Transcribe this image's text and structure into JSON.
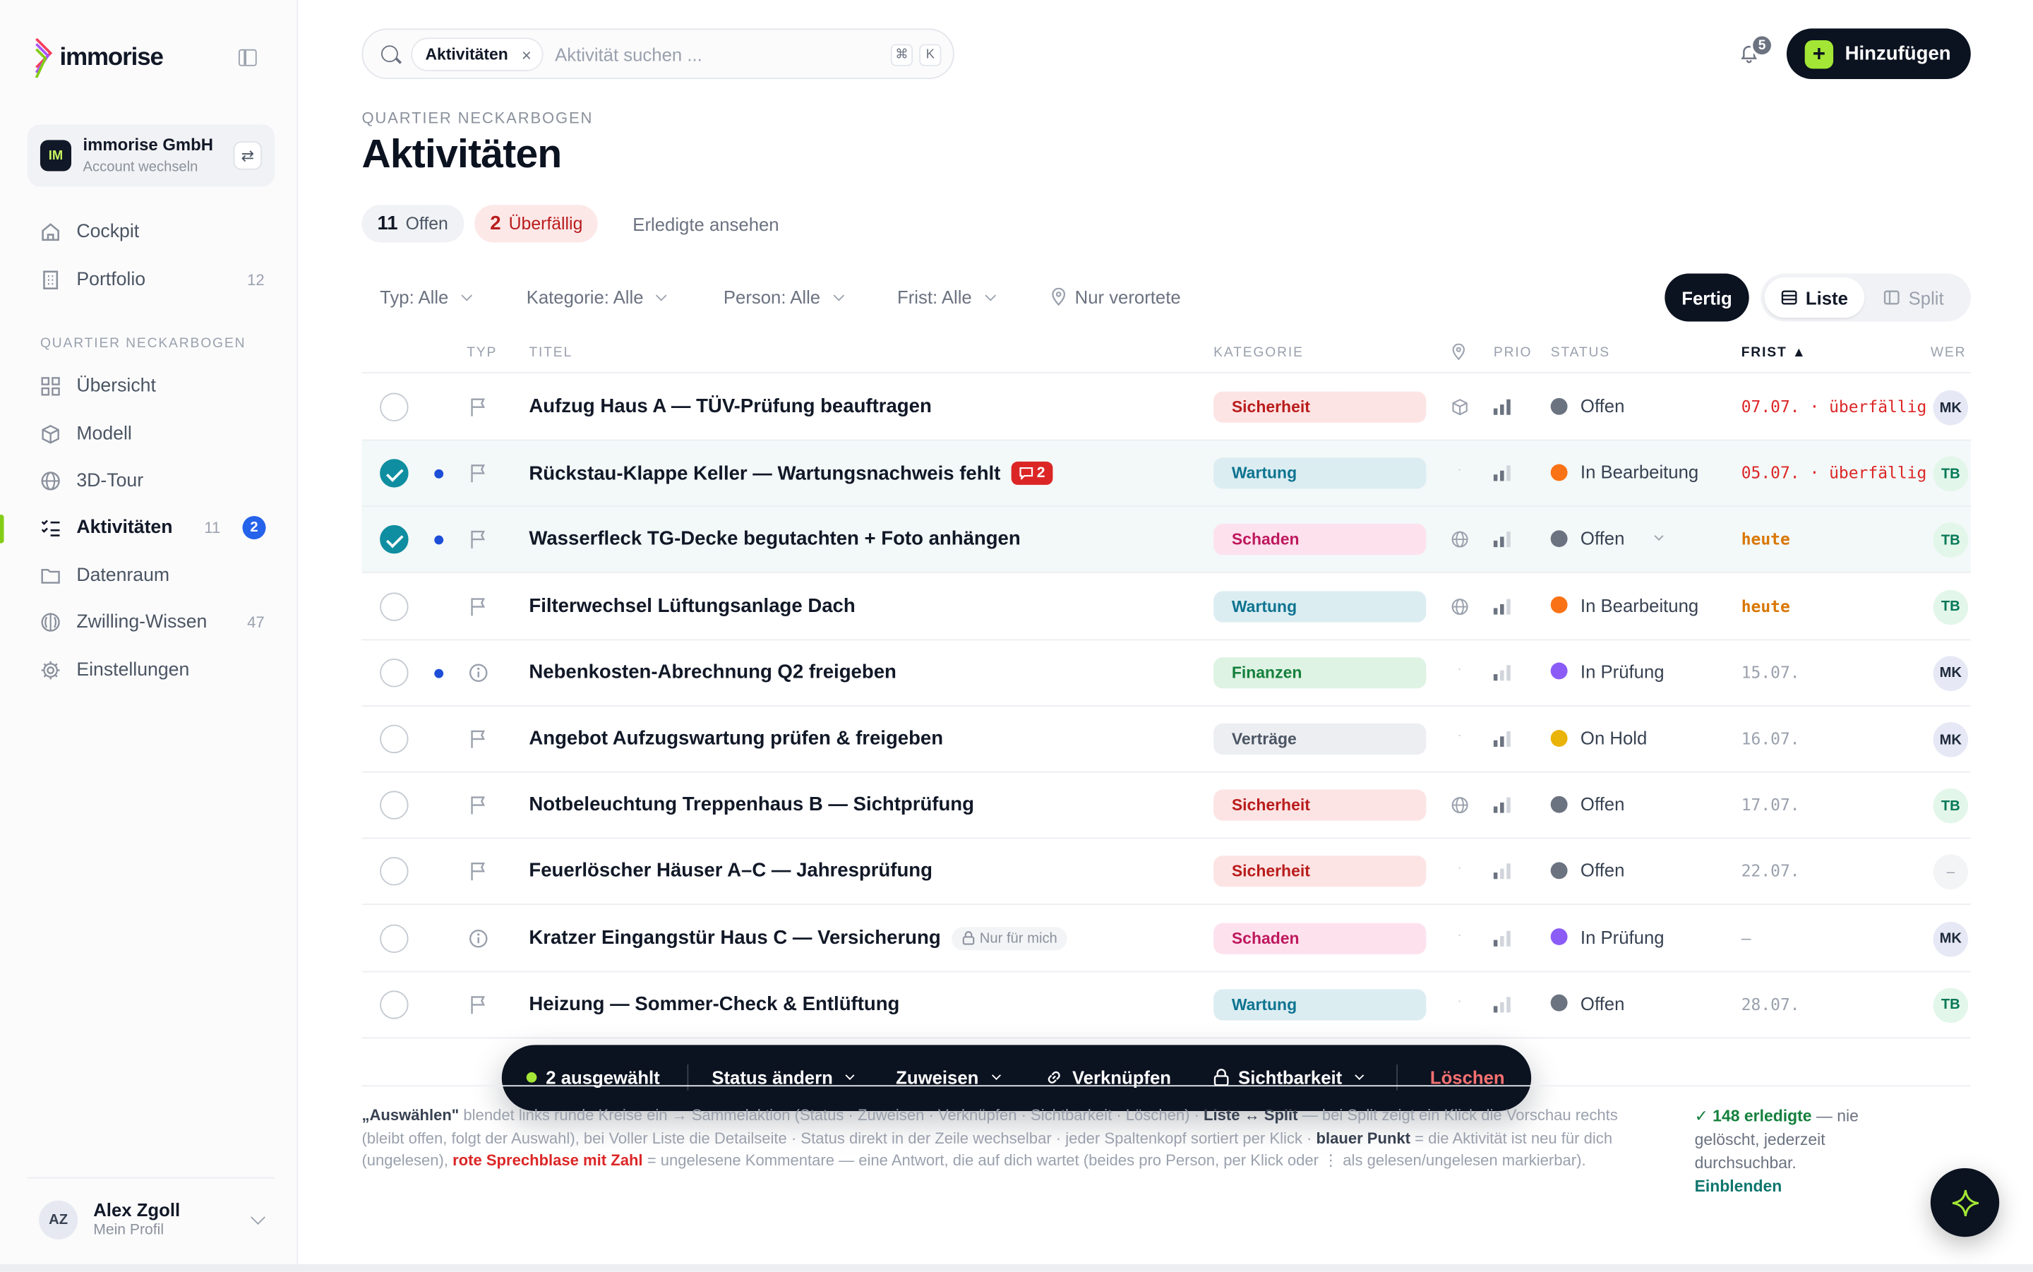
{
  "brand": {
    "name": "immorise"
  },
  "account": {
    "initials": "IM",
    "name": "immorise GmbH",
    "sub": "Account wechseln"
  },
  "nav": {
    "main": [
      {
        "label": "Cockpit",
        "icon": "home-icon",
        "count": ""
      },
      {
        "label": "Portfolio",
        "icon": "building-icon",
        "count": "12"
      }
    ],
    "section_label": "QUARTIER NECKARBOGEN",
    "section": [
      {
        "label": "Übersicht",
        "icon": "grid-icon",
        "count": ""
      },
      {
        "label": "Modell",
        "icon": "cube-icon",
        "count": ""
      },
      {
        "label": "3D-Tour",
        "icon": "globe-icon",
        "count": ""
      },
      {
        "label": "Aktivitäten",
        "icon": "checklist-icon",
        "count": "11",
        "badge": "2",
        "active": true
      },
      {
        "label": "Datenraum",
        "icon": "folder-icon",
        "count": ""
      },
      {
        "label": "Zwilling-Wissen",
        "icon": "brain-icon",
        "count": "47"
      },
      {
        "label": "Einstellungen",
        "icon": "gear-icon",
        "count": ""
      }
    ]
  },
  "profile": {
    "initials": "AZ",
    "name": "Alex Zgoll",
    "sub": "Mein Profil"
  },
  "search": {
    "chip": "Aktivitäten",
    "placeholder": "Aktivität suchen ...",
    "kbd1": "⌘",
    "kbd2": "K"
  },
  "notifications": {
    "count": "5"
  },
  "add_button": {
    "label": "Hinzufügen"
  },
  "header": {
    "eyebrow": "QUARTIER NECKARBOGEN",
    "title": "Aktivitäten"
  },
  "tabs": {
    "open": {
      "count": "11",
      "label": "Offen"
    },
    "overdue": {
      "count": "2",
      "label": "Überfällig"
    },
    "done": {
      "label": "Erledigte ansehen"
    }
  },
  "filters": [
    {
      "label": "Typ: Alle"
    },
    {
      "label": "Kategorie: Alle"
    },
    {
      "label": "Person: Alle"
    },
    {
      "label": "Frist: Alle"
    }
  ],
  "located_filter": "Nur verortete",
  "fertig_label": "Fertig",
  "view": {
    "list": "Liste",
    "split": "Split"
  },
  "columns": {
    "type": "TYP",
    "title": "TITEL",
    "category": "KATEGORIE",
    "prio": "PRIO",
    "status": "STATUS",
    "deadline": "FRIST ▲",
    "who": "WER"
  },
  "colors": {
    "Sicherheit": {
      "bg": "#fde4e4",
      "fg": "#b91c1c"
    },
    "Wartung": {
      "bg": "#dcedf2",
      "fg": "#0e7490"
    },
    "Schaden": {
      "bg": "#fde2ee",
      "fg": "#be185d"
    },
    "Finanzen": {
      "bg": "#def3e3",
      "fg": "#15803d"
    },
    "Verträge": {
      "bg": "#eceef2",
      "fg": "#4b5563"
    },
    "Offen": "#6b7280",
    "In Bearbeitung": "#f97316",
    "In Prüfung": "#8b5cf6",
    "On Hold": "#eab308"
  },
  "rows": [
    {
      "checked": false,
      "new": false,
      "type": "flag",
      "title": "Aufzug Haus A — TÜV-Prüfung beauftragen",
      "comments": "",
      "private": "",
      "category": "Sicherheit",
      "loc": "cube",
      "prio": 3,
      "status": "Offen",
      "status_dd": false,
      "deadline": "07.07.  · überfällig",
      "deadline_kind": "over",
      "who": "MK"
    },
    {
      "checked": true,
      "new": true,
      "type": "flag",
      "title": "Rückstau-Klappe Keller — Wartungsnachweis fehlt",
      "comments": "2",
      "private": "",
      "category": "Wartung",
      "loc": "none",
      "prio": 2,
      "status": "In Bearbeitung",
      "status_dd": false,
      "deadline": "05.07.  · überfällig",
      "deadline_kind": "over",
      "who": "TB"
    },
    {
      "checked": true,
      "new": true,
      "type": "flag",
      "title": "Wasserfleck TG-Decke begutachten + Foto anhängen",
      "comments": "",
      "private": "",
      "category": "Schaden",
      "loc": "globe",
      "prio": 2,
      "status": "Offen",
      "status_dd": true,
      "deadline": "heute",
      "deadline_kind": "today",
      "who": "TB"
    },
    {
      "checked": false,
      "new": false,
      "type": "flag",
      "title": "Filterwechsel Lüftungsanlage Dach",
      "comments": "",
      "private": "",
      "category": "Wartung",
      "loc": "globe",
      "prio": 2,
      "status": "In Bearbeitung",
      "status_dd": false,
      "deadline": "heute",
      "deadline_kind": "today",
      "who": "TB"
    },
    {
      "checked": false,
      "new": true,
      "type": "info",
      "title": "Nebenkosten-Abrechnung Q2 freigeben",
      "comments": "",
      "private": "",
      "category": "Finanzen",
      "loc": "none",
      "prio": 1,
      "status": "In Prüfung",
      "status_dd": false,
      "deadline": "15.07.",
      "deadline_kind": "normal",
      "who": "MK"
    },
    {
      "checked": false,
      "new": false,
      "type": "flag",
      "title": "Angebot Aufzugswartung prüfen & freigeben",
      "comments": "",
      "private": "",
      "category": "Verträge",
      "loc": "none",
      "prio": 2,
      "status": "On Hold",
      "status_dd": false,
      "deadline": "16.07.",
      "deadline_kind": "normal",
      "who": "MK"
    },
    {
      "checked": false,
      "new": false,
      "type": "flag",
      "title": "Notbeleuchtung Treppenhaus B — Sichtprüfung",
      "comments": "",
      "private": "",
      "category": "Sicherheit",
      "loc": "globe",
      "prio": 2,
      "status": "Offen",
      "status_dd": false,
      "deadline": "17.07.",
      "deadline_kind": "normal",
      "who": "TB"
    },
    {
      "checked": false,
      "new": false,
      "type": "flag",
      "title": "Feuerlöscher Häuser A–C — Jahresprüfung",
      "comments": "",
      "private": "",
      "category": "Sicherheit",
      "loc": "none",
      "prio": 1,
      "status": "Offen",
      "status_dd": false,
      "deadline": "22.07.",
      "deadline_kind": "normal",
      "who": "–"
    },
    {
      "checked": false,
      "new": false,
      "type": "info",
      "title": "Kratzer Eingangstür Haus C — Versicherung",
      "comments": "",
      "private": "Nur für mich",
      "category": "Schaden",
      "loc": "none",
      "prio": 1,
      "status": "In Prüfung",
      "status_dd": false,
      "deadline": "–",
      "deadline_kind": "normal",
      "who": "MK"
    },
    {
      "checked": false,
      "new": false,
      "type": "flag",
      "title": "Heizung — Sommer-Check & Entlüftung",
      "comments": "",
      "private": "",
      "category": "Wartung",
      "loc": "none",
      "prio": 1,
      "status": "Offen",
      "status_dd": false,
      "deadline": "28.07.",
      "deadline_kind": "normal",
      "who": "TB"
    }
  ],
  "bulk": {
    "selected": "2 ausgewählt",
    "status": "Status ändern",
    "assign": "Zuweisen",
    "link": "Verknüpfen",
    "visibility": "Sichtbarkeit",
    "delete": "Löschen"
  },
  "note": {
    "p1": "„Auswählen\"",
    "p2": " blendet links runde Kreise ein → Sammelaktion (Status · Zuweisen · Verknüpfen · Sichtbarkeit · Löschen) · ",
    "p3": "Liste ↔ Split",
    "p4": " — bei Split zeigt ein Klick die Vorschau rechts (bleibt offen, folgt der Auswahl), bei Voller Liste die Detailseite · Status direkt in der Zeile wechselbar · jeder Spaltenkopf sortiert per Klick · ",
    "p5": "blauer Punkt",
    "p6": " = die Aktivität ist neu für dich (ungelesen), ",
    "p7": "rote Sprechblase mit Zahl",
    "p8": " = ungelesene Kommentare — eine Antwort, die auf dich wartet (beides pro Person, per Klick oder ⋮ als gelesen/ungelesen markierbar)."
  },
  "done_note": {
    "count": "✓ 148 erledigte",
    "text": " — nie gelöscht, jederzeit durchsuchbar.",
    "link": "Einblenden"
  }
}
